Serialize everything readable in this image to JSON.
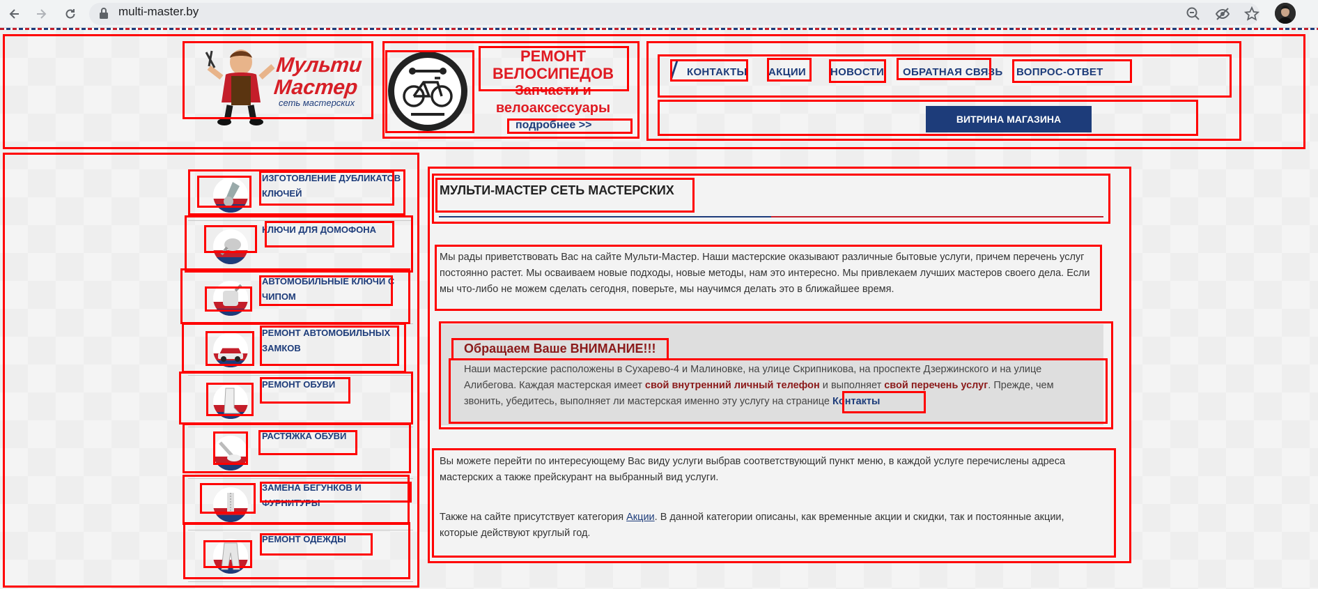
{
  "browser": {
    "url": "multi-master.by",
    "icons": [
      "back-icon",
      "forward-icon",
      "reload-icon",
      "lock-icon",
      "zoom-out-icon",
      "eye-off-icon",
      "star-icon",
      "profile-avatar"
    ]
  },
  "header": {
    "logo": {
      "line1": "Мульти",
      "line2": "Мастер",
      "subtitle": "сеть мастерских"
    },
    "bike_ad": {
      "line1": "РЕМОНТ",
      "line2": "ВЕЛОСИПЕДОВ",
      "line3": "Запчасти и",
      "line4": "велоаксессуары",
      "more": "подробнее >>"
    },
    "nav": [
      "КОНТАКТЫ",
      "АКЦИИ",
      "НОВОСТИ",
      "ОБРАТНАЯ СВЯЗЬ",
      "ВОПРОС-ОТВЕТ"
    ],
    "shop_button": "ВИТРИНА МАГАЗИНА"
  },
  "sidebar": {
    "items": [
      {
        "label": "ИЗГОТОВЛЕНИЕ ДУБЛИКАТОВ КЛЮЧЕЙ",
        "icon": "key-icon"
      },
      {
        "label": "КЛЮЧИ ДЛЯ ДОМОФОНА",
        "icon": "intercom-key-icon"
      },
      {
        "label": "АВТОМОБИЛЬНЫЕ КЛЮЧИ С ЧИПОМ",
        "icon": "car-key-icon"
      },
      {
        "label": "РЕМОНТ АВТОМОБИЛЬНЫХ ЗАМКОВ",
        "icon": "car-icon"
      },
      {
        "label": "РЕМОНТ ОБУВИ",
        "icon": "boot-icon"
      },
      {
        "label": "РАСТЯЖКА ОБУВИ",
        "icon": "shoe-stretch-icon"
      },
      {
        "label": "ЗАМЕНА БЕГУНКОВ И ФУРНИТУРЫ",
        "icon": "zipper-icon"
      },
      {
        "label": "РЕМОНТ ОДЕЖДЫ",
        "icon": "trousers-icon"
      }
    ]
  },
  "content": {
    "title": "МУЛЬТИ-МАСТЕР СЕТЬ МАСТЕРСКИХ",
    "intro": "Мы рады приветствовать Вас на сайте Мульти-Мастер. Наши мастерские оказывают различные бытовые услуги, причем перечень услуг постоянно растет. Мы осваиваем новые подходы, новые методы, нам это интересно. Мы привлекаем лучших мастеров своего дела. Если мы что-либо не можем сделать сегодня, поверьте, мы научимся делать это в ближайшее время.",
    "notice": {
      "title": "Обращаем Ваше ВНИМАНИЕ!!!",
      "text1": "Наши мастерские расположены в Сухарево-4 и Малиновке, на  улице Скрипникова, на проспекте Дзержинского и на  улице Алибегова. Каждая мастерская имеет ",
      "bold1": "свой внутренний личный телефон",
      "text2": " и выполняет ",
      "bold2": "свой перечень услуг",
      "text3": ". Прежде, чем звонить, убедитесь, выполняет ли мастерская именно эту услугу на странице ",
      "link": "Контакты"
    },
    "para2": "Вы можете перейти по интересующему Вас виду услуги выбрав соответствующий пункт меню, в каждой услуге перечислены адреса мастерских а также прейскурант на выбранный вид услуги.",
    "para3_a": "Также на сайте присутствует категория ",
    "para3_link": "Акции",
    "para3_b": ". В данной категории описаны, как временные акции и скидки, так и постоянные акции, которые действуют круглый год."
  },
  "colors": {
    "brand_red": "#d71f27",
    "brand_blue": "#1d3c7a",
    "annotation_red": "#ff0000"
  }
}
